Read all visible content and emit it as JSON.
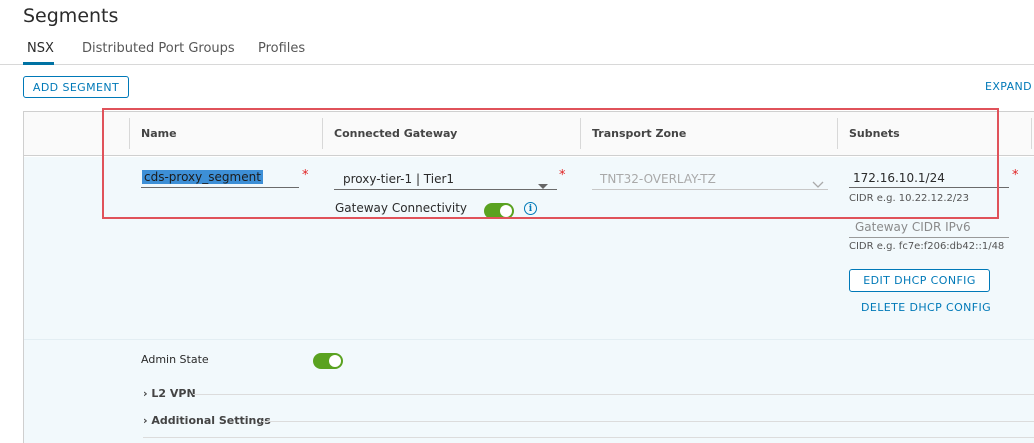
{
  "page": {
    "title": "Segments"
  },
  "tabs": [
    {
      "label": "NSX",
      "active": true
    },
    {
      "label": "Distributed Port Groups",
      "active": false
    },
    {
      "label": "Profiles",
      "active": false
    }
  ],
  "toolbar": {
    "add_segment": "ADD SEGMENT",
    "expand": "EXPAND"
  },
  "columns": {
    "name": "Name",
    "gateway": "Connected Gateway",
    "transport_zone": "Transport Zone",
    "subnets": "Subnets"
  },
  "segment": {
    "name": "cds-proxy_segment",
    "gateway": "proxy-tier-1 | Tier1",
    "gateway_connectivity_label": "Gateway Connectivity",
    "gateway_connectivity_on": true,
    "transport_zone": "TNT32-OVERLAY-TZ",
    "subnet": "172.16.10.1/24",
    "subnet_hint": "CIDR e.g. 10.22.12.2/23",
    "ipv6_placeholder": "Gateway CIDR IPv6",
    "ipv6_hint": "CIDR e.g. fc7e:f206:db42::1/48",
    "edit_dhcp": "EDIT DHCP CONFIG",
    "delete_dhcp": "DELETE DHCP CONFIG",
    "admin_state_label": "Admin State",
    "admin_state_on": true,
    "l2vpn_label": "L2 VPN",
    "additional_label": "Additional Settings",
    "required_mark": "*"
  },
  "icons": {
    "dropdown": "chevron-down-icon",
    "info": "info-icon",
    "expand": "chevron-right-icon"
  },
  "colors": {
    "accent": "#0079b8",
    "toggle_on": "#5aa220",
    "required": "#e02020",
    "highlight": "#e0525a"
  }
}
